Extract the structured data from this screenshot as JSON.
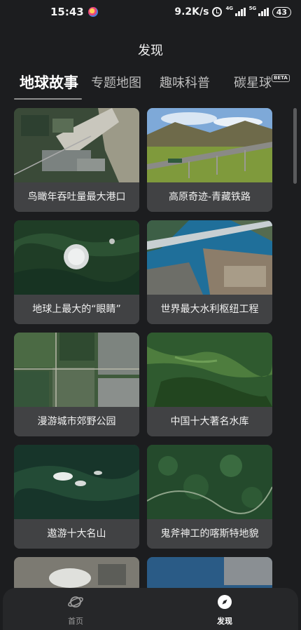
{
  "status_bar": {
    "time": "15:43",
    "net_speed": "9.2K/s",
    "sig1_tag": "4G",
    "sig2_tag": "5G",
    "battery": "43",
    "icons": [
      "app-notification-icon",
      "alarm-icon",
      "signal-icon",
      "battery-icon"
    ]
  },
  "header": {
    "title": "发现"
  },
  "tabs": [
    {
      "label": "地球故事",
      "active": true
    },
    {
      "label": "专题地图",
      "active": false
    },
    {
      "label": "趣味科普",
      "active": false
    },
    {
      "label": "碳星球",
      "active": false
    }
  ],
  "beta_badge": "BETA",
  "cards": [
    {
      "label": "鸟瞰年吞吐量最大港口"
    },
    {
      "label": "高原奇迹-青藏铁路"
    },
    {
      "label": "地球上最大的“眼睛”"
    },
    {
      "label": "世界最大水利枢纽工程"
    },
    {
      "label": "漫游城市郊野公园"
    },
    {
      "label": "中国十大著名水库"
    },
    {
      "label": "遨游十大名山"
    },
    {
      "label": "鬼斧神工的喀斯特地貌"
    }
  ],
  "nav": {
    "home_label": "首页",
    "discover_label": "发现",
    "icons": [
      "planet-icon",
      "compass-icon"
    ]
  }
}
